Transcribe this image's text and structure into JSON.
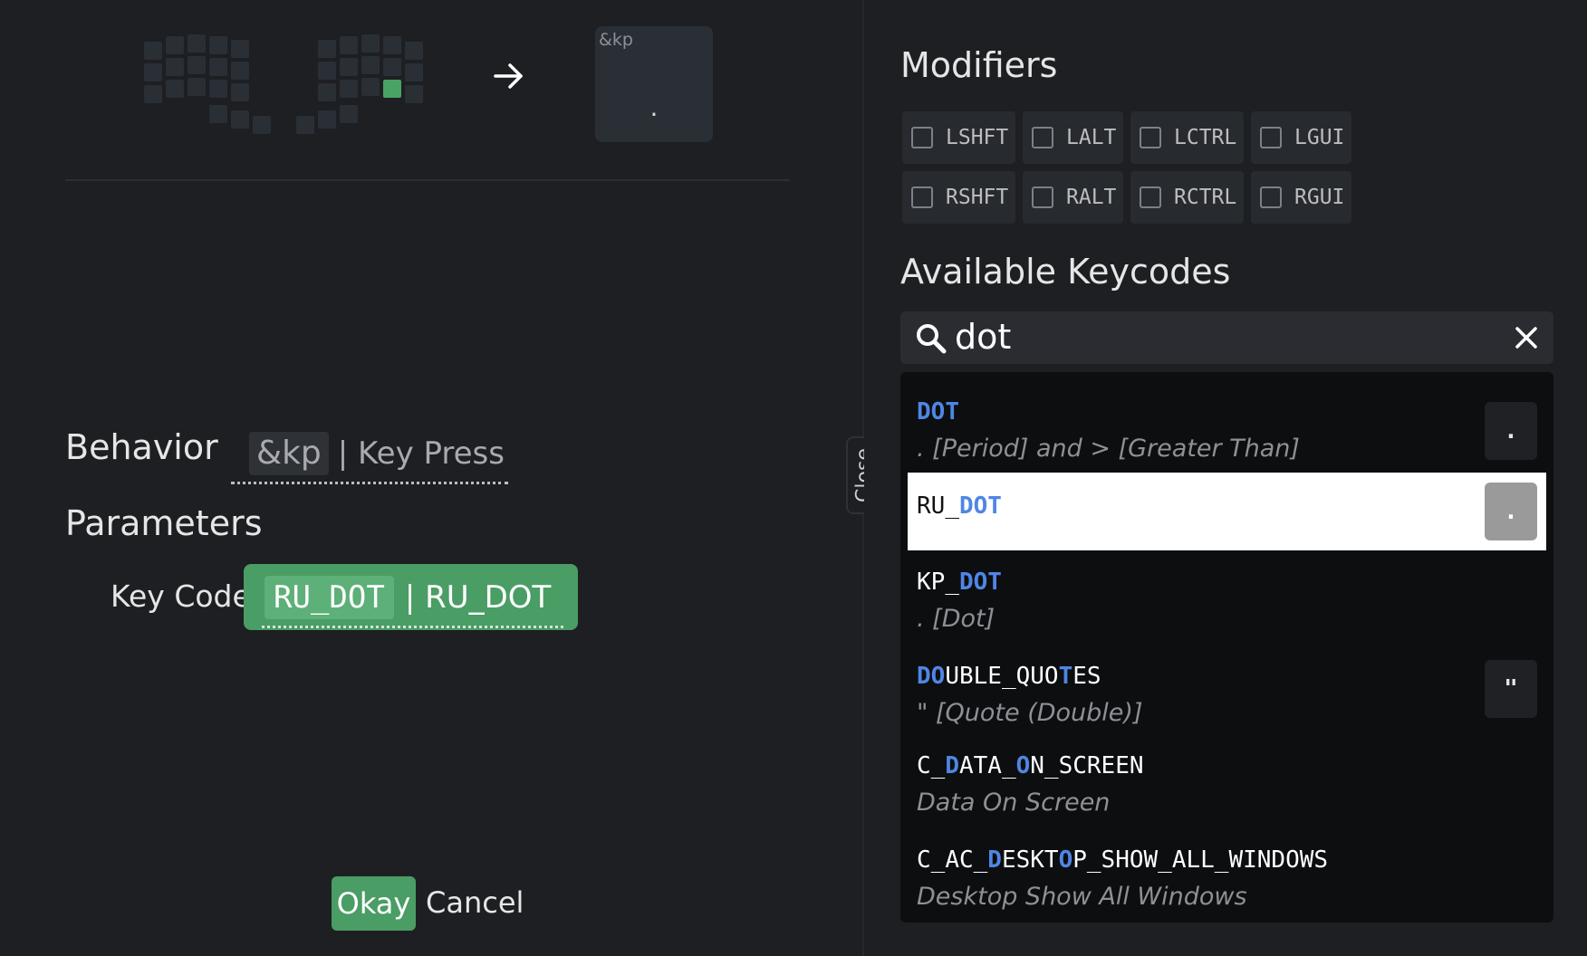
{
  "key_preview": {
    "behavior": "&kp",
    "glyph": "."
  },
  "behavior": {
    "heading": "Behavior",
    "code": "&kp",
    "description": "| Key Press"
  },
  "parameters": {
    "heading": "Parameters",
    "keycode_label": "Key Code",
    "value_code": "RU_DOT",
    "value_description": "| RU_DOT"
  },
  "footer": {
    "okay_label": "Okay",
    "cancel_label": "Cancel"
  },
  "close_tab_label": "Close",
  "modifiers": {
    "heading": "Modifiers",
    "items": [
      "LSHFT",
      "LALT",
      "LCTRL",
      "LGUI",
      "RSHFT",
      "RALT",
      "RCTRL",
      "RGUI"
    ]
  },
  "keycodes": {
    "heading": "Available Keycodes",
    "search_value": "dot",
    "results": [
      {
        "name": "DOT",
        "description": ". [Period] and > [Greater Than]",
        "glyph": "."
      },
      {
        "name": "RU_DOT",
        "description": "",
        "glyph": ".",
        "selected": true
      },
      {
        "name": "KP_DOT",
        "description": ". [Dot]",
        "glyph": ""
      },
      {
        "name": "DOUBLE_QUOTES",
        "description": "\" [Quote (Double)]",
        "glyph": "\""
      },
      {
        "name": "C_DATA_ON_SCREEN",
        "description": "Data On Screen",
        "glyph": ""
      },
      {
        "name": "C_AC_DESKTOP_SHOW_ALL_WINDOWS",
        "description": "Desktop Show All Windows",
        "glyph": ""
      }
    ]
  },
  "colors": {
    "accent_green": "#4a9d64",
    "match_blue": "#4f86e5",
    "background": "#1d1f22"
  }
}
